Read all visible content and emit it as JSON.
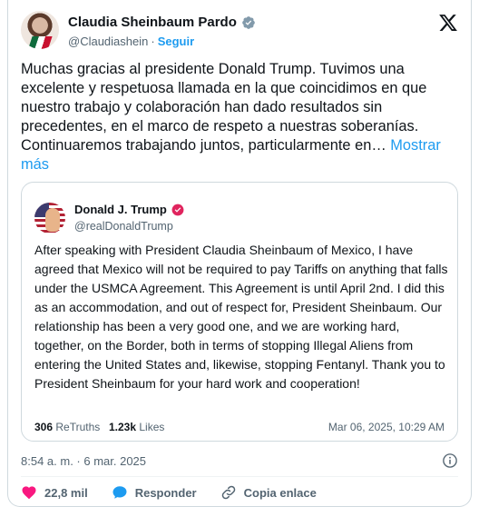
{
  "author": {
    "name": "Claudia Sheinbaum Pardo",
    "handle": "@Claudiashein",
    "separator": "·",
    "follow_label": "Seguir",
    "verified_color": "#829aab"
  },
  "post": {
    "text": "Muchas gracias al presidente Donald Trump. Tuvimos una excelente y respetuosa llamada en la que coincidimos en que nuestro trabajo y colaboración han dado resultados sin precedentes, en el marco de respeto a nuestras soberanías. Continuaremos trabajando juntos, particularmente en…",
    "more_label": "Mostrar más",
    "timestamp": "8:54 a. m. · 6 mar. 2025"
  },
  "quote": {
    "name": "Donald J. Trump",
    "handle": "@realDonaldTrump",
    "badge_color": "#e0245e",
    "body": "After speaking with President Claudia Sheinbaum of Mexico, I have agreed that Mexico will not be required to pay Tariffs on anything that falls under the USMCA Agreement. This Agreement is until April 2nd. I did this as an accommodation, and out of respect for, President Sheinbaum. Our relationship has been a very good one, and we are working hard, together, on the Border, both in terms of stopping Illegal Aliens from entering the United States and, likewise, stopping Fentanyl. Thank you to President Sheinbaum for your hard work and cooperation!",
    "retruths_count": "306",
    "retruths_label": "ReTruths",
    "likes_count": "1.23k",
    "likes_label": "Likes",
    "date": "Mar 06, 2025, 10:29 AM"
  },
  "actions": {
    "likes": "22,8 mil",
    "reply_label": "Responder",
    "copy_label": "Copia enlace"
  },
  "colors": {
    "accent": "#1d9bf0",
    "heart": "#f91880",
    "muted": "#536471"
  },
  "icons": [
    "verified-badge-icon",
    "x-logo-icon",
    "info-icon",
    "heart-icon",
    "reply-bubble-icon",
    "link-icon"
  ]
}
